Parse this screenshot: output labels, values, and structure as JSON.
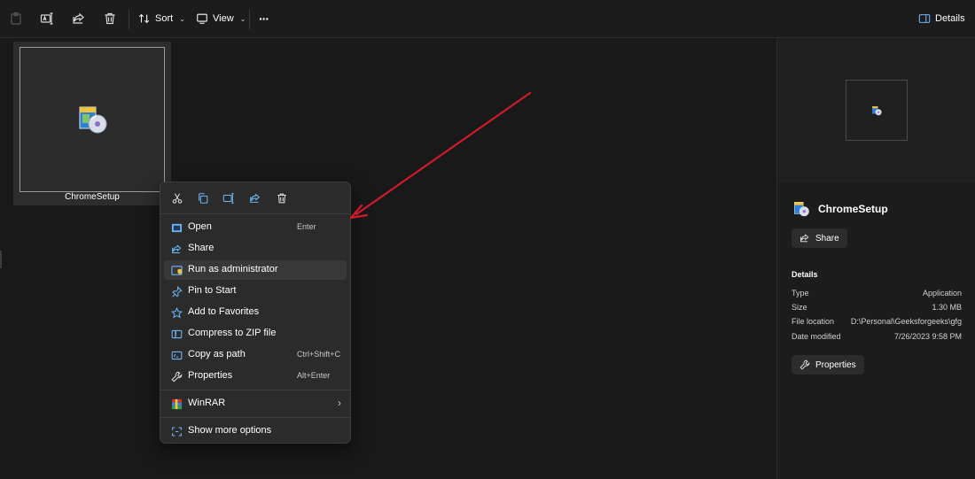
{
  "toolbar": {
    "sort_label": "Sort",
    "view_label": "View",
    "more_label": "···",
    "details_label": "Details"
  },
  "file": {
    "name": "ChromeSetup"
  },
  "context_menu": {
    "quick_actions": [
      "cut-icon",
      "copy-icon",
      "rename-icon",
      "share-icon",
      "delete-icon"
    ],
    "items": [
      {
        "label": "Open",
        "shortcut": "Enter",
        "icon": "open-icon"
      },
      {
        "label": "Share",
        "shortcut": "",
        "icon": "share-icon"
      },
      {
        "label": "Run as administrator",
        "shortcut": "",
        "icon": "shield-icon"
      },
      {
        "label": "Pin to Start",
        "shortcut": "",
        "icon": "pin-icon"
      },
      {
        "label": "Add to Favorites",
        "shortcut": "",
        "icon": "star-icon"
      },
      {
        "label": "Compress to ZIP file",
        "shortcut": "",
        "icon": "zip-icon"
      },
      {
        "label": "Copy as path",
        "shortcut": "Ctrl+Shift+C",
        "icon": "copy-path-icon"
      },
      {
        "label": "Properties",
        "shortcut": "Alt+Enter",
        "icon": "wrench-icon"
      },
      {
        "label": "WinRAR",
        "shortcut": "",
        "icon": "winrar-icon"
      },
      {
        "label": "Show more options",
        "shortcut": "",
        "icon": "more-options-icon"
      }
    ]
  },
  "details_pane": {
    "title": "ChromeSetup",
    "share_label": "Share",
    "section_heading": "Details",
    "properties": [
      {
        "key": "Type",
        "value": "Application"
      },
      {
        "key": "Size",
        "value": "1.30 MB"
      },
      {
        "key": "File location",
        "value": "D:\\Personal\\Geeksforgeeks\\gfg"
      },
      {
        "key": "Date modified",
        "value": "7/26/2023 9:58 PM"
      }
    ],
    "properties_button_label": "Properties"
  },
  "colors": {
    "accent": "#6cb6f5",
    "annotation_arrow": "#d01c2a",
    "menu_bg": "#2b2b2b",
    "window_bg": "#1c1c1c"
  }
}
